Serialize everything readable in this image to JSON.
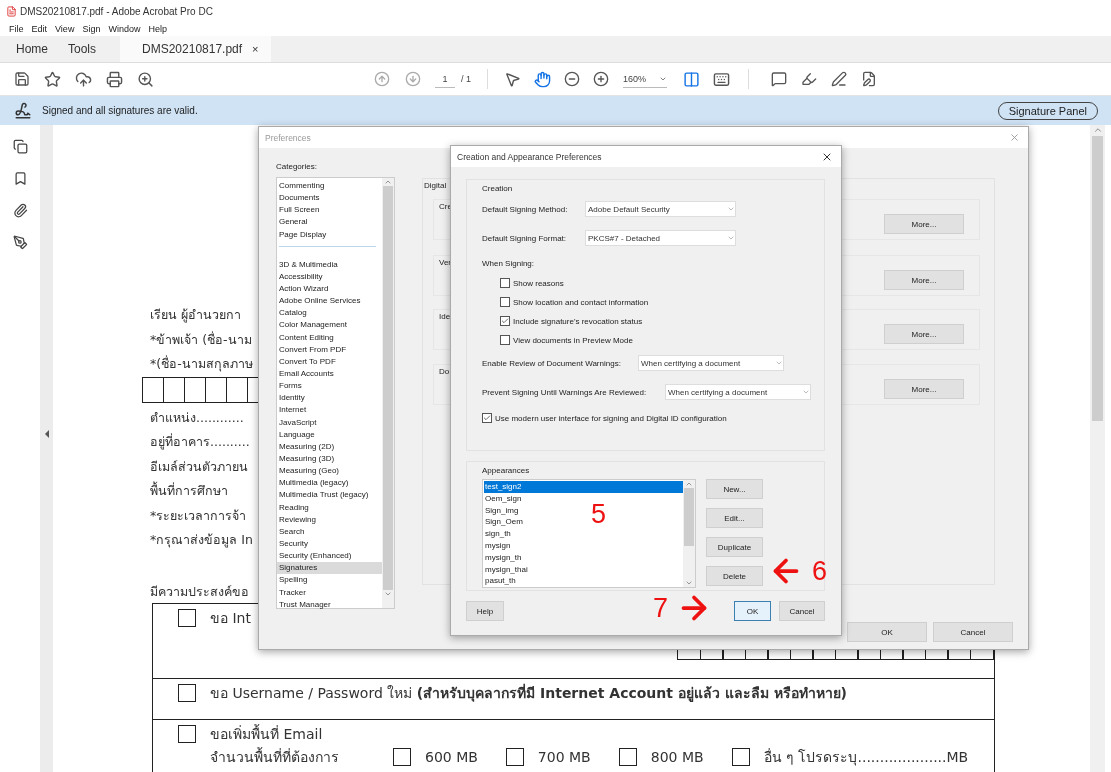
{
  "window": {
    "title": "DMS20210817.pdf - Adobe Acrobat Pro DC"
  },
  "menu": [
    "File",
    "Edit",
    "View",
    "Sign",
    "Window",
    "Help"
  ],
  "tabs": [
    {
      "label": "Home",
      "selected": false
    },
    {
      "label": "Tools",
      "selected": false
    },
    {
      "label": "DMS20210817.pdf",
      "selected": true,
      "close": "×"
    }
  ],
  "toolbar": {
    "page": "1",
    "page_total": "/ 1",
    "zoom": "160%",
    "tools": [
      {
        "kind": "pointer",
        "selected": false
      },
      {
        "kind": "hand",
        "selected": true
      }
    ]
  },
  "signature_bar": {
    "message": "Signed and all signatures are valid.",
    "button": "Signature Panel"
  },
  "document": {
    "lines": [
      {
        "kind": "text",
        "text": "เรียน   ผู้อำนวยกา"
      },
      {
        "kind": "text",
        "text": "*ข้าพเจ้า (ชื่อ-นาม"
      },
      {
        "kind": "text",
        "text": "*(ชื่อ-นามสกุลภาษ"
      },
      {
        "kind": "boxes"
      },
      {
        "kind": "text",
        "text": "ตำแหน่ง............"
      },
      {
        "kind": "text",
        "text": "อยู่ที่อาคาร.........."
      },
      {
        "kind": "text",
        "text": "อีเมล์ส่วนตัวภายน"
      },
      {
        "kind": "text",
        "text": "พื้นที่การศึกษา"
      },
      {
        "kind": "text",
        "text": "*ระยะเวลาการจ้า"
      },
      {
        "kind": "text",
        "text": "*กรุณาส่งข้อมูล In"
      }
    ],
    "intent": "มีความประสงค์ขอ",
    "requests": [
      {
        "kind": "id",
        "label": "ขอ Int",
        "checked": false
      },
      {
        "kind": "plain",
        "label": "ขอ Username / Password ใหม่ **(สำหรับบุคลากรที่มี Internet Account อยู่แล้ว และลืม หรือทำหาย)**",
        "checked": false
      },
      {
        "kind": "quota",
        "label": "ขอเพิ่มพื้นที่ Email",
        "checked": false,
        "sub_label": "จำนวนพื้นที่ที่ต้องการ",
        "options": [
          {
            "label": "600 MB",
            "checked": false
          },
          {
            "label": "700 MB",
            "checked": false
          },
          {
            "label": "800 MB",
            "checked": false
          },
          {
            "label": "อื่น ๆ โปรดระบุ....................MB",
            "checked": false
          }
        ]
      }
    ]
  },
  "preferences": {
    "title": "Preferences",
    "categories_label": "Categories:",
    "category_groups": [
      [
        {
          "label": "Commenting",
          "selected": false
        },
        {
          "label": "Documents",
          "selected": false
        },
        {
          "label": "Full Screen",
          "selected": false
        },
        {
          "label": "General",
          "selected": false
        },
        {
          "label": "Page Display",
          "selected": false
        }
      ],
      [
        {
          "label": "3D & Multimedia",
          "selected": false
        },
        {
          "label": "Accessibility",
          "selected": false
        },
        {
          "label": "Action Wizard",
          "selected": false
        },
        {
          "label": "Adobe Online Services",
          "selected": false
        },
        {
          "label": "Catalog",
          "selected": false
        },
        {
          "label": "Color Management",
          "selected": false
        },
        {
          "label": "Content Editing",
          "selected": false
        },
        {
          "label": "Convert From PDF",
          "selected": false
        },
        {
          "label": "Convert To PDF",
          "selected": false
        },
        {
          "label": "Email Accounts",
          "selected": false
        },
        {
          "label": "Forms",
          "selected": false
        },
        {
          "label": "Identity",
          "selected": false
        },
        {
          "label": "Internet",
          "selected": false
        },
        {
          "label": "JavaScript",
          "selected": false
        },
        {
          "label": "Language",
          "selected": false
        },
        {
          "label": "Measuring (2D)",
          "selected": false
        },
        {
          "label": "Measuring (3D)",
          "selected": false
        },
        {
          "label": "Measuring (Geo)",
          "selected": false
        },
        {
          "label": "Multimedia (legacy)",
          "selected": false
        },
        {
          "label": "Multimedia Trust (legacy)",
          "selected": false
        },
        {
          "label": "Reading",
          "selected": false
        },
        {
          "label": "Reviewing",
          "selected": false
        },
        {
          "label": "Search",
          "selected": false
        },
        {
          "label": "Security",
          "selected": false
        },
        {
          "label": "Security (Enhanced)",
          "selected": false
        },
        {
          "label": "Signatures",
          "selected": true
        },
        {
          "label": "Spelling",
          "selected": false
        },
        {
          "label": "Tracker",
          "selected": false
        },
        {
          "label": "Trust Manager",
          "selected": false
        }
      ]
    ],
    "group_label": "Digital",
    "sections": [
      {
        "label": "Cre",
        "button": "More..."
      },
      {
        "label": "Ver",
        "button": "More..."
      },
      {
        "label": "Ide",
        "button": "More..."
      },
      {
        "label": "Do",
        "button": "More..."
      }
    ],
    "buttons": [
      "OK",
      "Cancel"
    ]
  },
  "creation_dialog": {
    "title": "Creation and Appearance Preferences",
    "creation_label": "Creation",
    "fields": [
      {
        "label": "Default Signing Method:",
        "value": "Adobe Default Security"
      },
      {
        "label": "Default Signing Format:",
        "value": "PKCS#7 - Detached"
      }
    ],
    "when_signing": "When Signing:",
    "options": [
      {
        "label": "Show reasons",
        "checked": false
      },
      {
        "label": "Show location and contact information",
        "checked": false
      },
      {
        "label": "Include signature's revocation status",
        "checked": true
      },
      {
        "label": "View documents in Preview Mode",
        "checked": false
      }
    ],
    "review_fields": [
      {
        "label": "Enable Review of Document Warnings:",
        "value": "When certifying a document"
      },
      {
        "label": "Prevent Signing Until Warnings Are Reviewed:",
        "value": "When certifying a document"
      }
    ],
    "modern_ui": {
      "label": "Use modern user interface for signing and Digital ID configuration",
      "checked": true
    },
    "appearances_label": "Appearances",
    "appearances": [
      {
        "label": "test_sign2",
        "selected": true
      },
      {
        "label": "Oem_sign",
        "selected": false
      },
      {
        "label": "Sign_img",
        "selected": false
      },
      {
        "label": "Sign_Oem",
        "selected": false
      },
      {
        "label": "sign_th",
        "selected": false
      },
      {
        "label": "mysign",
        "selected": false
      },
      {
        "label": "mysign_th",
        "selected": false
      },
      {
        "label": "mysign_thai",
        "selected": false
      },
      {
        "label": "pasut_th",
        "selected": false
      }
    ],
    "appearance_buttons": [
      "New...",
      "Edit...",
      "Duplicate",
      "Delete"
    ],
    "help": "Help",
    "ok": "OK",
    "cancel": "Cancel"
  },
  "annotations": [
    {
      "kind": "number",
      "label": "5"
    },
    {
      "kind": "arrow_left",
      "label": "6"
    },
    {
      "kind": "arrow_right",
      "label": "7"
    }
  ]
}
